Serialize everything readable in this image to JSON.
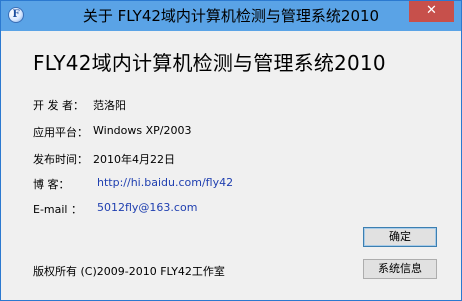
{
  "window": {
    "title": "关于 FLY42域内计算机检测与管理系统2010",
    "close_glyph": "✕"
  },
  "heading": "FLY42域内计算机检测与管理系统2010",
  "info": [
    {
      "label": "开 发 者：",
      "value": "范洛阳"
    },
    {
      "label": "应用平台：",
      "value": "Windows XP/2003"
    },
    {
      "label": "发布时间：",
      "value": "2010年4月22日"
    },
    {
      "label": "博    客：",
      "value": "http://hi.baidu.com/fly42"
    },
    {
      "label": "E-mail ：",
      "value": "5012fly@163.com"
    }
  ],
  "copyright": "版权所有 (C)2009-2010 FLY42工作室",
  "buttons": {
    "ok": "确定",
    "sysinfo": "系统信息"
  }
}
